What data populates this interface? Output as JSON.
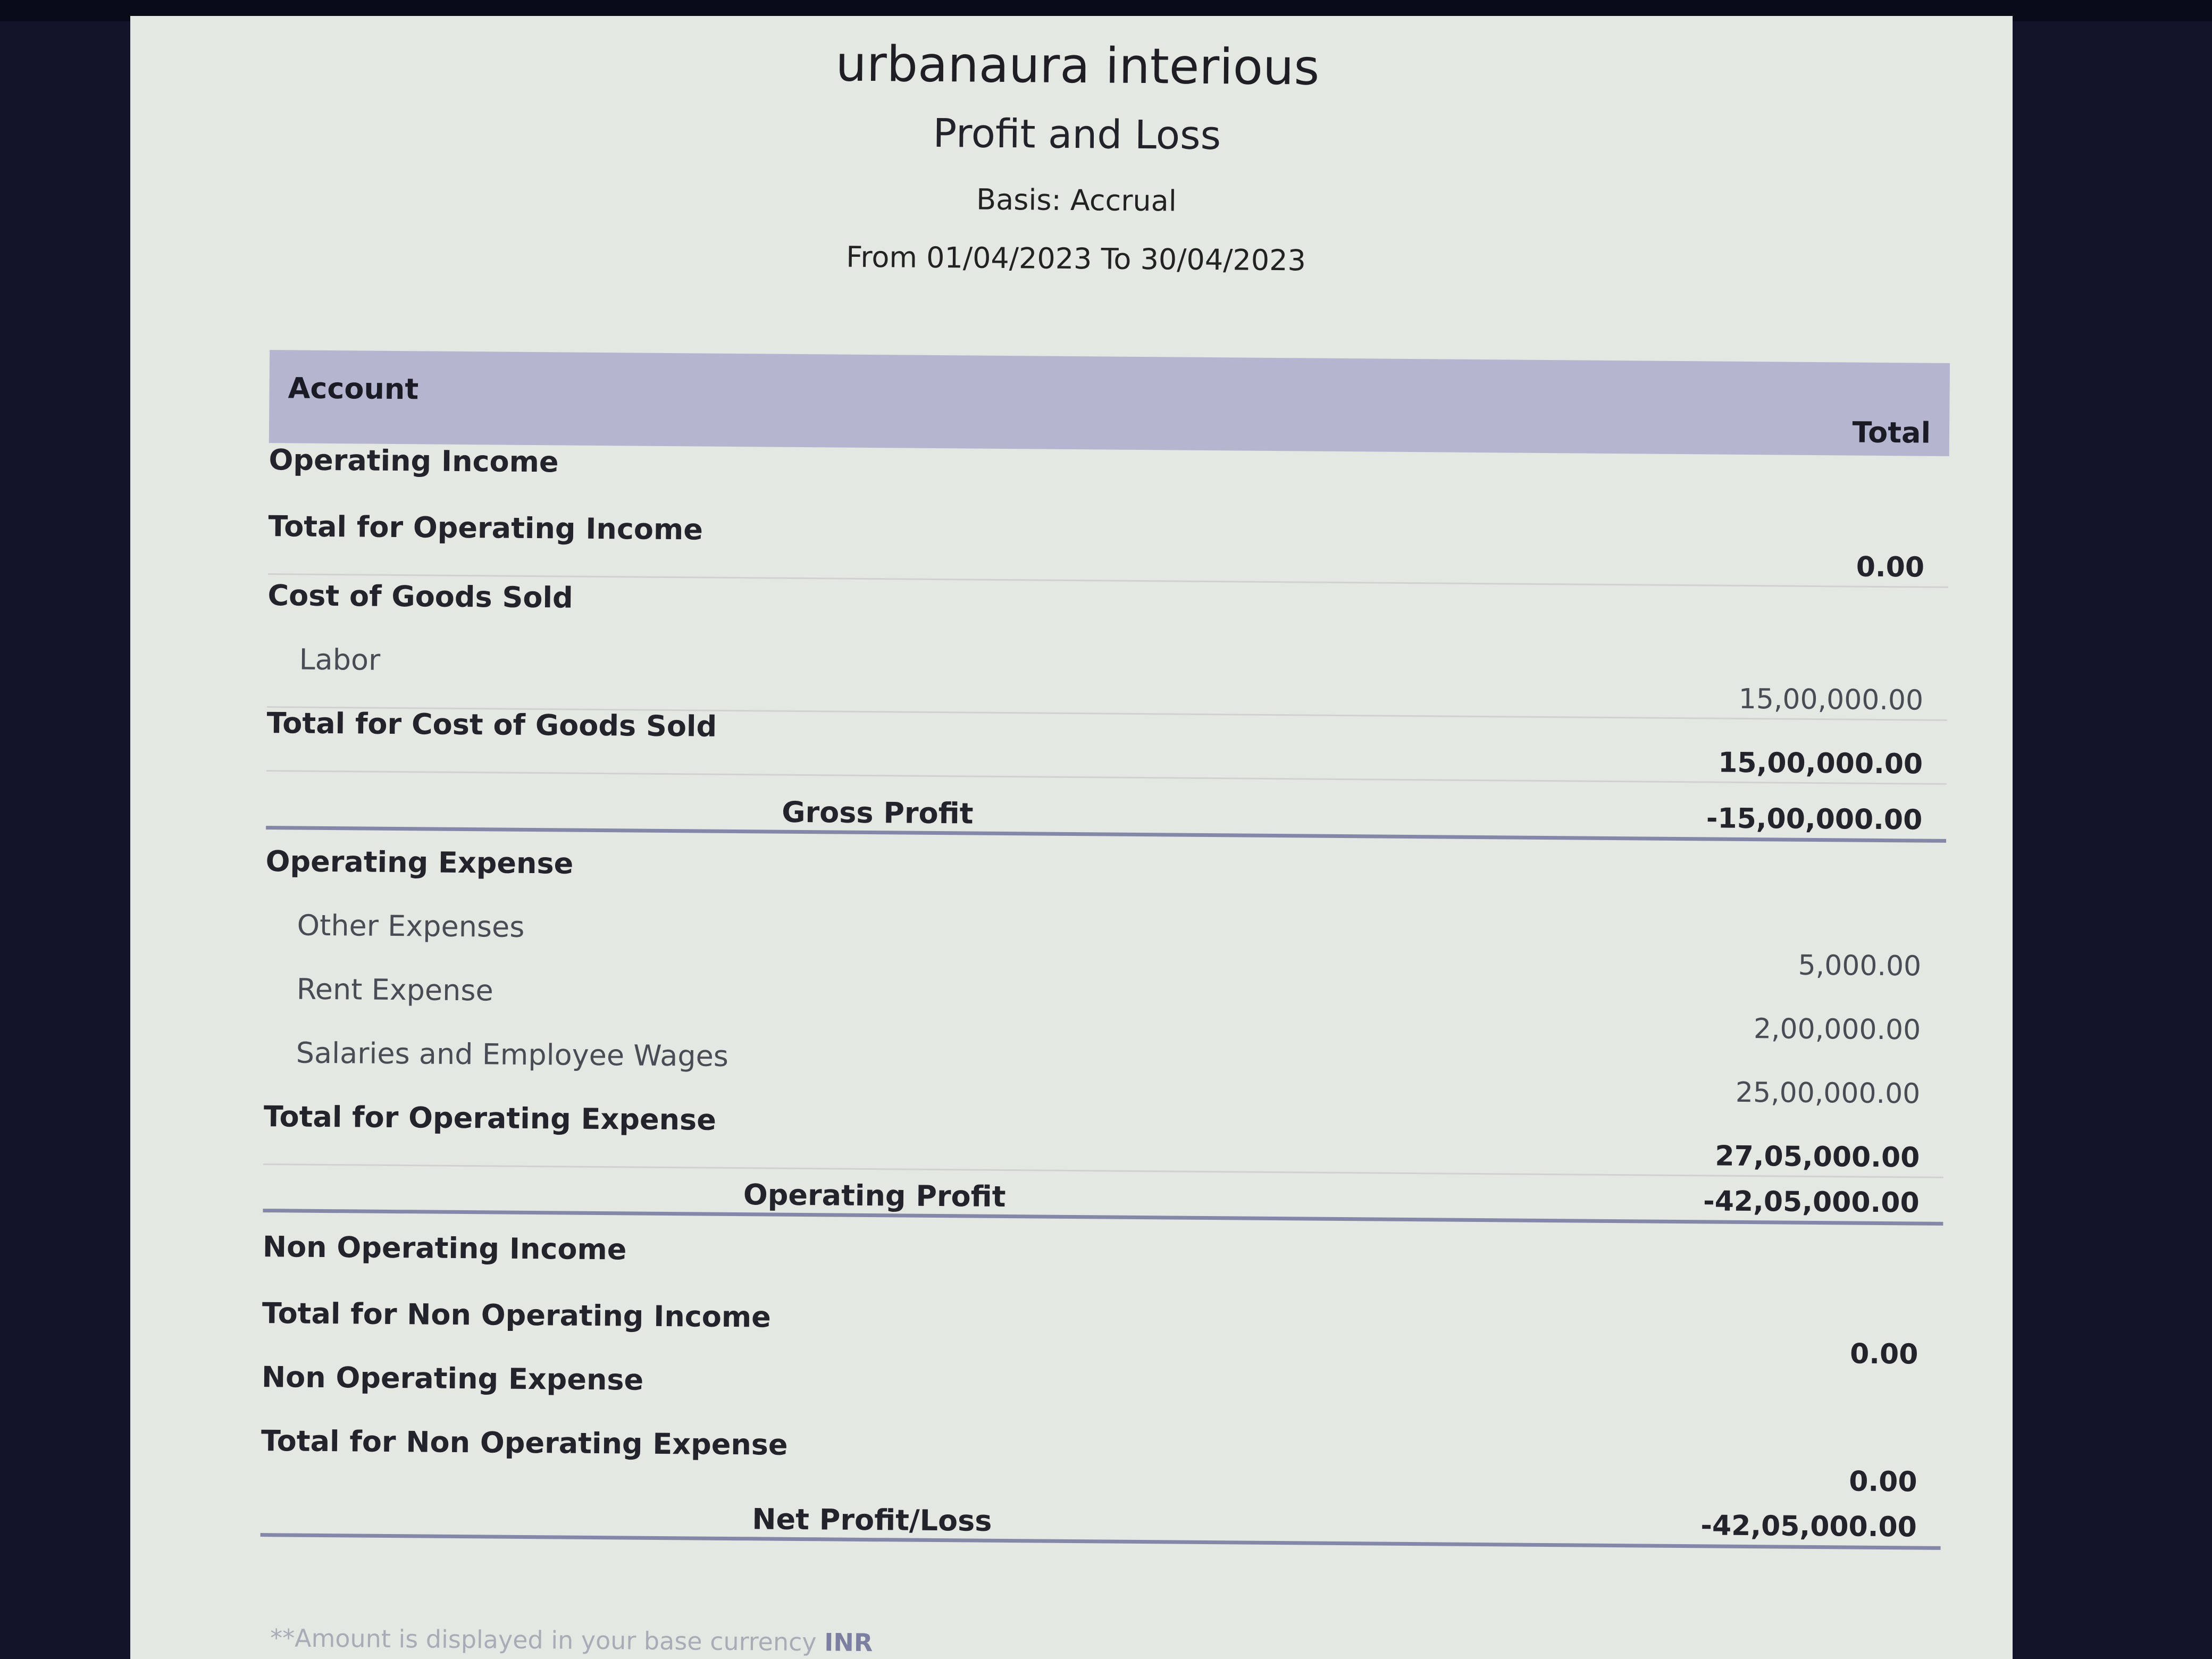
{
  "report": {
    "organization": "urbanaura interious",
    "title": "Profit and Loss",
    "basis": "Basis: Accrual",
    "period": "From 01/04/2023 To 30/04/2023"
  },
  "table": {
    "header": {
      "account": "Account",
      "total": "Total"
    },
    "rows": [
      {
        "label": "Operating Income",
        "amount": "",
        "kind": "section"
      },
      {
        "label": "Total for Operating Income",
        "amount": "0.00",
        "kind": "total"
      },
      {
        "label": "Cost of Goods Sold",
        "amount": "",
        "kind": "section"
      },
      {
        "label": "Labor",
        "amount": "15,00,000.00",
        "kind": "item"
      },
      {
        "label": "Total for Cost of Goods Sold",
        "amount": "15,00,000.00",
        "kind": "total"
      },
      {
        "label": "Gross Profit",
        "amount": "-15,00,000.00",
        "kind": "summary"
      },
      {
        "label": "Operating Expense",
        "amount": "",
        "kind": "section"
      },
      {
        "label": "Other Expenses",
        "amount": "5,000.00",
        "kind": "item"
      },
      {
        "label": "Rent Expense",
        "amount": "2,00,000.00",
        "kind": "item"
      },
      {
        "label": "Salaries and Employee Wages",
        "amount": "25,00,000.00",
        "kind": "item"
      },
      {
        "label": "Total for Operating Expense",
        "amount": "27,05,000.00",
        "kind": "total"
      },
      {
        "label": "Operating Profit",
        "amount": "-42,05,000.00",
        "kind": "summary"
      },
      {
        "label": "Non Operating Income",
        "amount": "",
        "kind": "section"
      },
      {
        "label": "Total for Non Operating Income",
        "amount": "0.00",
        "kind": "total"
      },
      {
        "label": "Non Operating Expense",
        "amount": "",
        "kind": "section"
      },
      {
        "label": "Total for Non Operating Expense",
        "amount": "0.00",
        "kind": "total"
      },
      {
        "label": "Net Profit/Loss",
        "amount": "-42,05,000.00",
        "kind": "summary"
      }
    ]
  },
  "footnote": {
    "text": "**Amount is displayed in your base currency",
    "currency": "INR"
  },
  "colors": {
    "header_band": "#b4b6d0",
    "summary_rule": "#8587a8",
    "paper": "#e4e8e2"
  }
}
